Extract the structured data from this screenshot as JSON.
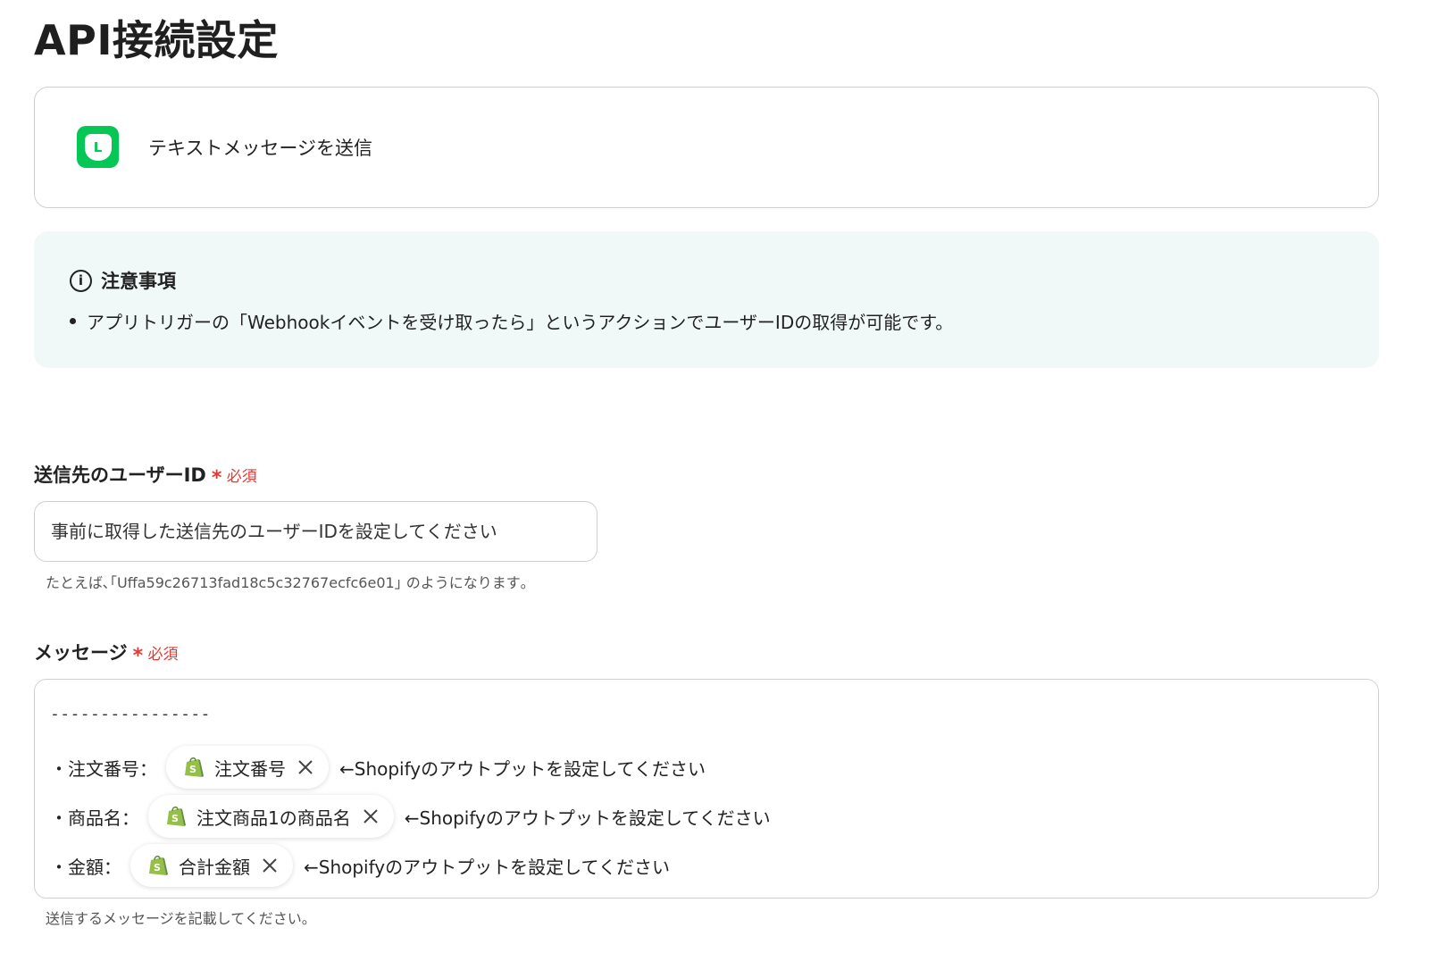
{
  "page": {
    "title": "API接続設定"
  },
  "action": {
    "app_logo_letter": "L",
    "label": "テキストメッセージを送信",
    "logo_color": "#06c755"
  },
  "notice": {
    "icon": "info-icon",
    "title": "注意事項",
    "items": [
      "アプリトリガーの「Webhookイベントを受け取ったら」というアクションでユーザーIDの取得が可能です。"
    ]
  },
  "user_id_field": {
    "label": "送信先のユーザーID",
    "required_star": "*",
    "required_text": "必須",
    "placeholder": "事前に取得した送信先のユーザーIDを設定してください",
    "hint": "たとえば､｢Uffa59c26713fad18c5c32767ecfc6e01｣ のようになります｡"
  },
  "message_field": {
    "label": "メッセージ",
    "required_star": "*",
    "required_text": "必須",
    "divider": "----------------",
    "rows": [
      {
        "label": "・注文番号：",
        "chip": "注文番号",
        "after": "←Shopifyのアウトプットを設定してください"
      },
      {
        "label": "・商品名：",
        "chip": "注文商品1の商品名",
        "after": "←Shopifyのアウトプットを設定してください"
      },
      {
        "label": "・金額：",
        "chip": "合計金額",
        "after": "←Shopifyのアウトプットを設定してください"
      }
    ],
    "hint": "送信するメッセージを記載してください。"
  },
  "colors": {
    "required": "#e53935",
    "notice_bg": "#f1f9f8",
    "shopify": "#95bf47"
  }
}
